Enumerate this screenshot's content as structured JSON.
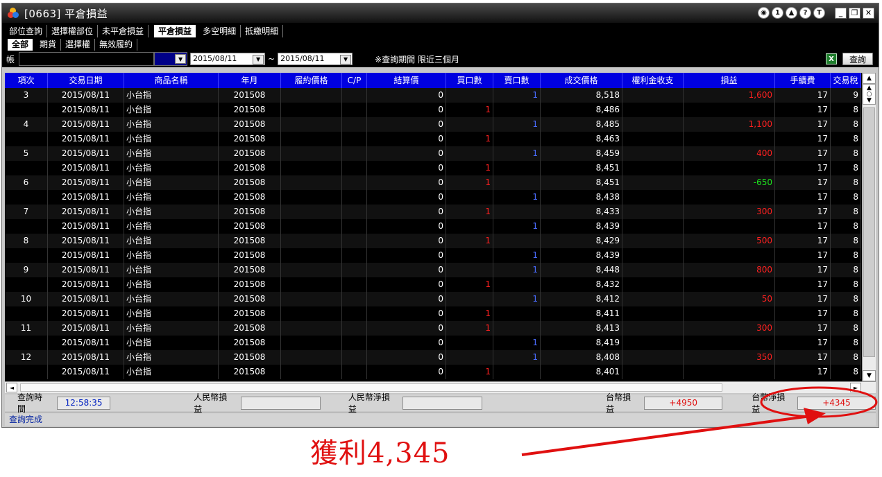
{
  "window": {
    "title": "[0663] 平倉損益"
  },
  "title_controls": {
    "c1": "◉",
    "c2": "1",
    "c3": "▲",
    "c4": "?",
    "c5": "T",
    "minimize": "_",
    "restore": "❐",
    "close": "✕"
  },
  "tabs_primary": [
    {
      "label": "部位查詢",
      "active": false
    },
    {
      "label": "選擇權部位",
      "active": false
    },
    {
      "label": "未平倉損益",
      "active": false
    },
    {
      "label": "平倉損益",
      "active": true
    },
    {
      "label": "多空明細",
      "active": false
    },
    {
      "label": "抵繳明細",
      "active": false
    }
  ],
  "tabs_secondary": [
    {
      "label": "全部",
      "active": true
    },
    {
      "label": "期貨",
      "active": false
    },
    {
      "label": "選擇權",
      "active": false
    },
    {
      "label": "無效履約",
      "active": false
    }
  ],
  "toolbar": {
    "account_label": "帳",
    "date_from": "2015/08/11",
    "tilde": "~",
    "date_to": "2015/08/11",
    "note": "※查詢期間 限近三個月",
    "export_icon": "X",
    "query_label": "查詢"
  },
  "table": {
    "headers": [
      "項次",
      "交易日期",
      "商品名稱",
      "年月",
      "履約價格",
      "C/P",
      "結算價",
      "買口數",
      "賣口數",
      "成交價格",
      "權利金收支",
      "損益",
      "手續費",
      "交易稅"
    ],
    "rows": [
      {
        "no": "3",
        "date": "2015/08/11",
        "name": "小台指",
        "ym": "201508",
        "strike": "",
        "cp": "",
        "settle": "0",
        "buy": "",
        "sell": "1",
        "price": "8,518",
        "premium": "",
        "pl": "1,600",
        "pl_color": "red",
        "fee": "17",
        "tax": "9"
      },
      {
        "no": "",
        "date": "2015/08/11",
        "name": "小台指",
        "ym": "201508",
        "strike": "",
        "cp": "",
        "settle": "0",
        "buy": "1",
        "sell": "",
        "price": "8,486",
        "premium": "",
        "pl": "",
        "pl_color": "",
        "fee": "17",
        "tax": "8"
      },
      {
        "no": "4",
        "date": "2015/08/11",
        "name": "小台指",
        "ym": "201508",
        "strike": "",
        "cp": "",
        "settle": "0",
        "buy": "",
        "sell": "1",
        "price": "8,485",
        "premium": "",
        "pl": "1,100",
        "pl_color": "red",
        "fee": "17",
        "tax": "8"
      },
      {
        "no": "",
        "date": "2015/08/11",
        "name": "小台指",
        "ym": "201508",
        "strike": "",
        "cp": "",
        "settle": "0",
        "buy": "1",
        "sell": "",
        "price": "8,463",
        "premium": "",
        "pl": "",
        "pl_color": "",
        "fee": "17",
        "tax": "8"
      },
      {
        "no": "5",
        "date": "2015/08/11",
        "name": "小台指",
        "ym": "201508",
        "strike": "",
        "cp": "",
        "settle": "0",
        "buy": "",
        "sell": "1",
        "price": "8,459",
        "premium": "",
        "pl": "400",
        "pl_color": "red",
        "fee": "17",
        "tax": "8"
      },
      {
        "no": "",
        "date": "2015/08/11",
        "name": "小台指",
        "ym": "201508",
        "strike": "",
        "cp": "",
        "settle": "0",
        "buy": "1",
        "sell": "",
        "price": "8,451",
        "premium": "",
        "pl": "",
        "pl_color": "",
        "fee": "17",
        "tax": "8"
      },
      {
        "no": "6",
        "date": "2015/08/11",
        "name": "小台指",
        "ym": "201508",
        "strike": "",
        "cp": "",
        "settle": "0",
        "buy": "1",
        "sell": "",
        "price": "8,451",
        "premium": "",
        "pl": "-650",
        "pl_color": "green",
        "fee": "17",
        "tax": "8"
      },
      {
        "no": "",
        "date": "2015/08/11",
        "name": "小台指",
        "ym": "201508",
        "strike": "",
        "cp": "",
        "settle": "0",
        "buy": "",
        "sell": "1",
        "price": "8,438",
        "premium": "",
        "pl": "",
        "pl_color": "",
        "fee": "17",
        "tax": "8"
      },
      {
        "no": "7",
        "date": "2015/08/11",
        "name": "小台指",
        "ym": "201508",
        "strike": "",
        "cp": "",
        "settle": "0",
        "buy": "1",
        "sell": "",
        "price": "8,433",
        "premium": "",
        "pl": "300",
        "pl_color": "red",
        "fee": "17",
        "tax": "8"
      },
      {
        "no": "",
        "date": "2015/08/11",
        "name": "小台指",
        "ym": "201508",
        "strike": "",
        "cp": "",
        "settle": "0",
        "buy": "",
        "sell": "1",
        "price": "8,439",
        "premium": "",
        "pl": "",
        "pl_color": "",
        "fee": "17",
        "tax": "8"
      },
      {
        "no": "8",
        "date": "2015/08/11",
        "name": "小台指",
        "ym": "201508",
        "strike": "",
        "cp": "",
        "settle": "0",
        "buy": "1",
        "sell": "",
        "price": "8,429",
        "premium": "",
        "pl": "500",
        "pl_color": "red",
        "fee": "17",
        "tax": "8"
      },
      {
        "no": "",
        "date": "2015/08/11",
        "name": "小台指",
        "ym": "201508",
        "strike": "",
        "cp": "",
        "settle": "0",
        "buy": "",
        "sell": "1",
        "price": "8,439",
        "premium": "",
        "pl": "",
        "pl_color": "",
        "fee": "17",
        "tax": "8"
      },
      {
        "no": "9",
        "date": "2015/08/11",
        "name": "小台指",
        "ym": "201508",
        "strike": "",
        "cp": "",
        "settle": "0",
        "buy": "",
        "sell": "1",
        "price": "8,448",
        "premium": "",
        "pl": "800",
        "pl_color": "red",
        "fee": "17",
        "tax": "8"
      },
      {
        "no": "",
        "date": "2015/08/11",
        "name": "小台指",
        "ym": "201508",
        "strike": "",
        "cp": "",
        "settle": "0",
        "buy": "1",
        "sell": "",
        "price": "8,432",
        "premium": "",
        "pl": "",
        "pl_color": "",
        "fee": "17",
        "tax": "8"
      },
      {
        "no": "10",
        "date": "2015/08/11",
        "name": "小台指",
        "ym": "201508",
        "strike": "",
        "cp": "",
        "settle": "0",
        "buy": "",
        "sell": "1",
        "price": "8,412",
        "premium": "",
        "pl": "50",
        "pl_color": "red",
        "fee": "17",
        "tax": "8"
      },
      {
        "no": "",
        "date": "2015/08/11",
        "name": "小台指",
        "ym": "201508",
        "strike": "",
        "cp": "",
        "settle": "0",
        "buy": "1",
        "sell": "",
        "price": "8,411",
        "premium": "",
        "pl": "",
        "pl_color": "",
        "fee": "17",
        "tax": "8"
      },
      {
        "no": "11",
        "date": "2015/08/11",
        "name": "小台指",
        "ym": "201508",
        "strike": "",
        "cp": "",
        "settle": "0",
        "buy": "1",
        "sell": "",
        "price": "8,413",
        "premium": "",
        "pl": "300",
        "pl_color": "red",
        "fee": "17",
        "tax": "8"
      },
      {
        "no": "",
        "date": "2015/08/11",
        "name": "小台指",
        "ym": "201508",
        "strike": "",
        "cp": "",
        "settle": "0",
        "buy": "",
        "sell": "1",
        "price": "8,419",
        "premium": "",
        "pl": "",
        "pl_color": "",
        "fee": "17",
        "tax": "8"
      },
      {
        "no": "12",
        "date": "2015/08/11",
        "name": "小台指",
        "ym": "201508",
        "strike": "",
        "cp": "",
        "settle": "0",
        "buy": "",
        "sell": "1",
        "price": "8,408",
        "premium": "",
        "pl": "350",
        "pl_color": "red",
        "fee": "17",
        "tax": "8"
      },
      {
        "no": "",
        "date": "2015/08/11",
        "name": "小台指",
        "ym": "201508",
        "strike": "",
        "cp": "",
        "settle": "0",
        "buy": "1",
        "sell": "",
        "price": "8,401",
        "premium": "",
        "pl": "",
        "pl_color": "",
        "fee": "17",
        "tax": "8"
      }
    ]
  },
  "scrollbar": {
    "up": "▲",
    "mid": "○",
    "down": "▼",
    "top": "▲",
    "bottom": "▼",
    "left": "◄",
    "right": "►"
  },
  "summary": {
    "query_time_label": "查詢時間",
    "query_time": "12:58:35",
    "rmb_pl_label": "人民幣損益",
    "rmb_pl": "",
    "rmb_net_label": "人民幣淨損益",
    "rmb_net": "",
    "twd_pl_label": "台幣損益",
    "twd_pl": "+4950",
    "twd_net_label": "台幣淨損益",
    "twd_net": "+4345"
  },
  "status": {
    "text": "查詢完成"
  },
  "annotation": {
    "text": "獲利4,345"
  },
  "colors": {
    "header_bg": "#0000e0",
    "positive": "#ff2020",
    "negative": "#1ee81e",
    "buy_sell_blue": "#4a6cff",
    "annotation_red": "#e01010"
  }
}
